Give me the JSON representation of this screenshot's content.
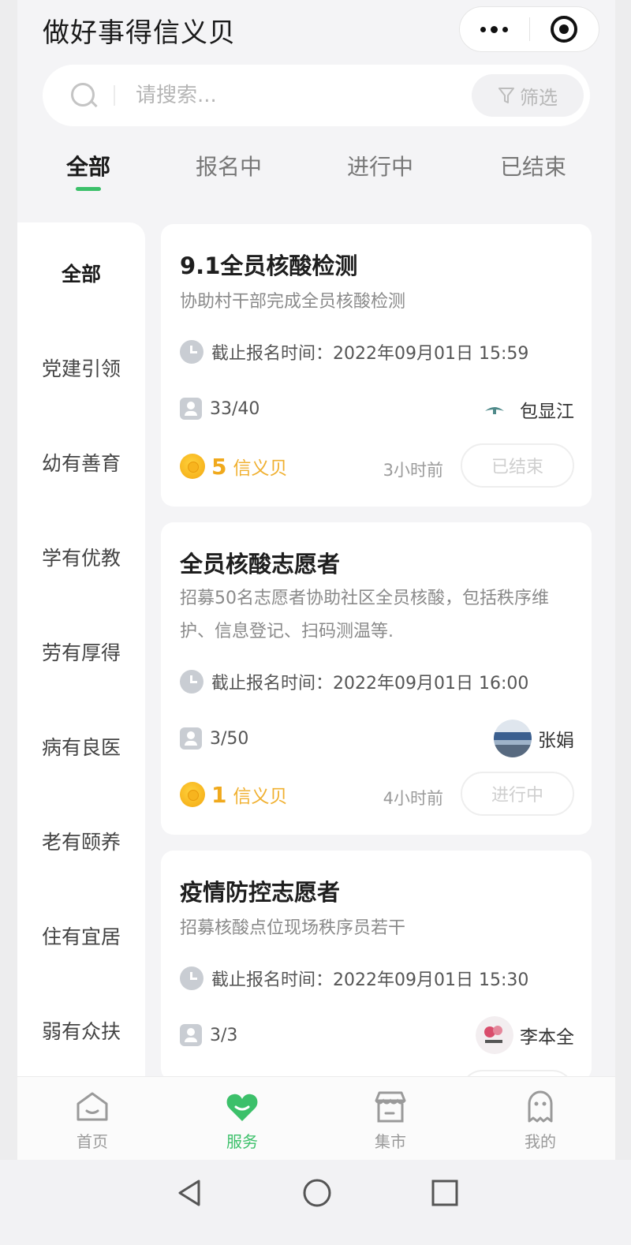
{
  "header": {
    "title": "做好事得信义贝"
  },
  "search": {
    "placeholder": "请搜索...",
    "filter_label": "筛选"
  },
  "status_tabs": [
    "全部",
    "报名中",
    "进行中",
    "已结束"
  ],
  "categories": [
    "全部",
    "党建引领",
    "幼有善育",
    "学有优教",
    "劳有厚得",
    "病有良医",
    "老有颐养",
    "住有宜居",
    "弱有众扶"
  ],
  "activities": [
    {
      "title": "9.1全员核酸检测",
      "description": "协助村干部完成全员核酸检测",
      "deadline": "截止报名时间：2022年09月01日 15:59",
      "participants": "33/40",
      "organizer": "包显江",
      "reward_points": "5",
      "reward_unit": "信义贝",
      "time_ago": "3小时前",
      "status": "已结束"
    },
    {
      "title": "全员核酸志愿者",
      "description": "招募50名志愿者协助社区全员核酸，包括秩序维护、信息登记、扫码测温等.",
      "deadline": "截止报名时间：2022年09月01日 16:00",
      "participants": "3/50",
      "organizer": "张娟",
      "reward_points": "1",
      "reward_unit": "信义贝",
      "time_ago": "4小时前",
      "status": "进行中"
    },
    {
      "title": "疫情防控志愿者",
      "description": "招募核酸点位现场秩序员若干",
      "deadline": "截止报名时间：2022年09月01日 15:30",
      "participants": "3/3",
      "organizer": "李本全"
    }
  ],
  "bottom_nav": [
    {
      "label": "首页",
      "icon": "home-icon"
    },
    {
      "label": "服务",
      "icon": "heart-icon"
    },
    {
      "label": "集市",
      "icon": "store-icon"
    },
    {
      "label": "我的",
      "icon": "ghost-icon"
    }
  ],
  "colors": {
    "accent": "#3cc06a",
    "reward": "#f0a91c"
  }
}
